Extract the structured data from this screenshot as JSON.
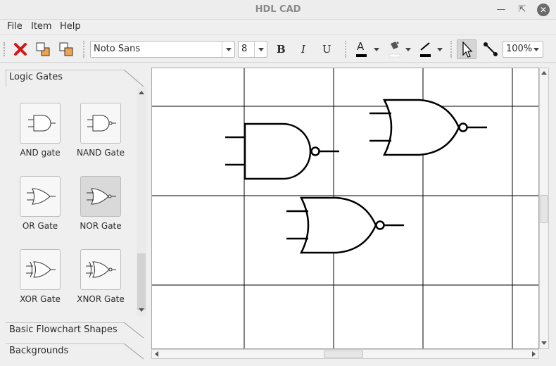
{
  "window": {
    "title": "HDL CAD"
  },
  "menubar": {
    "file": "File",
    "item": "Item",
    "help": "Help"
  },
  "toolbar": {
    "font_family": "Noto Sans",
    "font_size": "8",
    "bold": "B",
    "italic": "I",
    "underline": "U",
    "text_color_glyph": "A",
    "zoom": "100%"
  },
  "left_panel": {
    "sections": [
      "Logic Gates",
      "Basic Flowchart Shapes",
      "Backgrounds"
    ],
    "gates": [
      "AND gate",
      "NAND Gate",
      "OR Gate",
      "NOR Gate",
      "XOR Gate",
      "XNOR Gate"
    ]
  },
  "colors": {
    "accent_red": "#d01818",
    "orange": "#f0a050",
    "canvas_bg": "#ffffff",
    "grid": "#000000"
  }
}
